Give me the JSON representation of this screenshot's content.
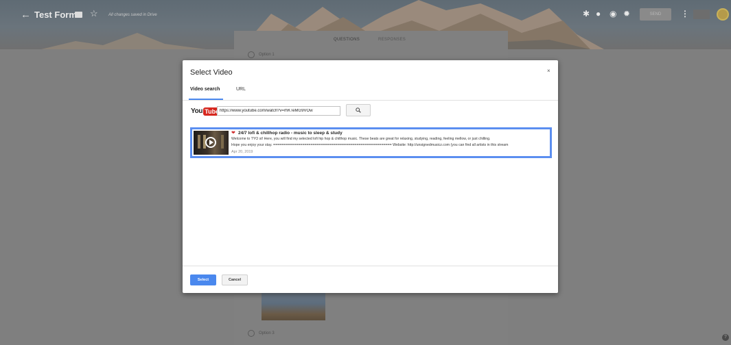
{
  "header": {
    "back_icon": "arrow-left-icon",
    "title": "Test Form",
    "save_status": "All changes saved in Drive",
    "send_label": "SEND",
    "icons": [
      "puzzle-icon",
      "palette-icon",
      "eye-icon",
      "gear-icon",
      "more-vert-icon",
      "avatar"
    ]
  },
  "form": {
    "tabs": [
      "QUESTIONS",
      "RESPONSES"
    ],
    "active_tab": "QUESTIONS",
    "options": [
      "Option 1",
      "Option 3"
    ]
  },
  "dialog": {
    "title": "Select Video",
    "close_label": "×",
    "tabs": [
      "Video search",
      "URL"
    ],
    "active_tab": "Video search",
    "logo": {
      "you": "You",
      "tube": "Tube"
    },
    "search_value": "https://www.youtube.com/watch?v=rhKTeMG9VOw",
    "result": {
      "title": "24/7 lofi & chillhop radio - music to sleep & study",
      "description_line1": "Welcome to TYO st! Here, you will find my selected lofi hip hop & chillhop music. These beats are great for relaxing, studying, reading, feeling mellow, or just chilling.",
      "description_line2": "Hope you enjoy your stay. ========================================================= Website: http://unsignedmusicz.com (you can find all artists in this stream",
      "date": "Apr 20, 2019"
    },
    "select_label": "Select",
    "cancel_label": "Cancel"
  },
  "colors": {
    "accent": "#4a88ee",
    "youtube_red": "#d6271e",
    "overlay": "#7f7f7f"
  }
}
